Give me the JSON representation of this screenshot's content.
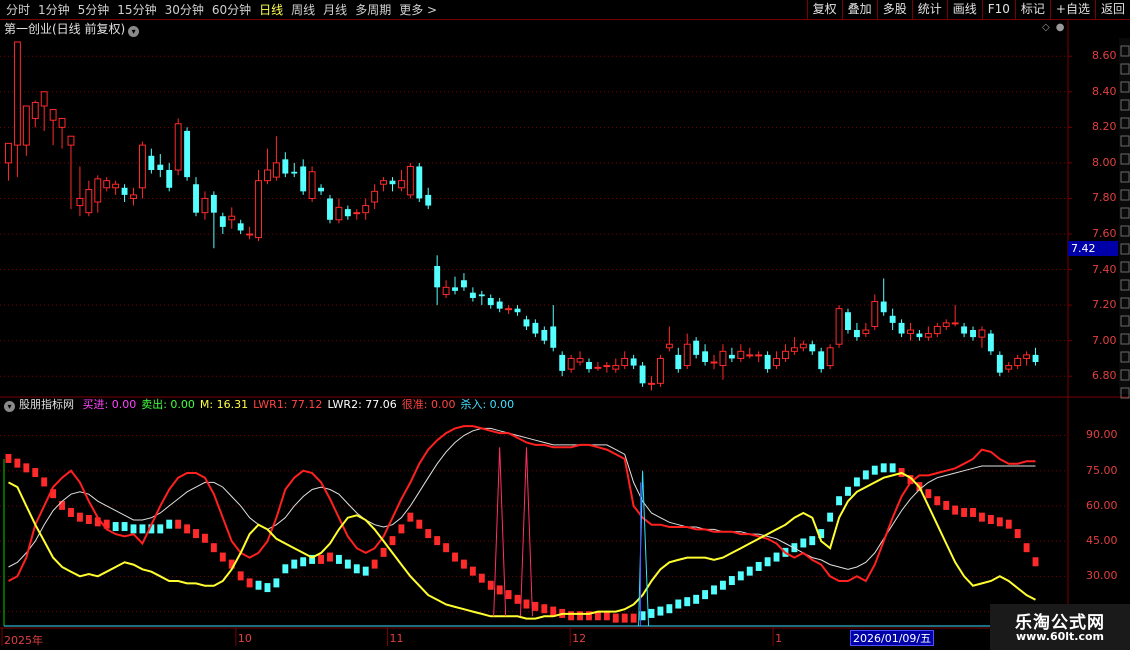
{
  "toolbar": {
    "tabs": [
      "分时",
      "1分钟",
      "5分钟",
      "15分钟",
      "30分钟",
      "60分钟",
      "日线",
      "周线",
      "月线",
      "多周期",
      "更多 >"
    ],
    "active_tab": "日线",
    "right_buttons": [
      "复权",
      "叠加",
      "多股",
      "统计",
      "画线",
      "F10",
      "标记",
      "+自选",
      "返回"
    ]
  },
  "chart_title": "第一创业(日线 前复权)",
  "indicator": {
    "name": "股朋指标网",
    "values": [
      {
        "label": "买进: 0.00",
        "color": "#ff44ff"
      },
      {
        "label": "卖出: 0.00",
        "color": "#44ff44"
      },
      {
        "label": "M: 16.31",
        "color": "#ffff44"
      },
      {
        "label": "LWR1: 77.12",
        "color": "#ff4444"
      },
      {
        "label": "LWR2: 77.06",
        "color": "#ffffff"
      },
      {
        "label": "很准: 0.00",
        "color": "#ff4444"
      },
      {
        "label": "杀入: 0.00",
        "color": "#44e0ff"
      }
    ]
  },
  "price_axis": [
    "8.60",
    "8.40",
    "8.20",
    "8.00",
    "7.80",
    "7.60",
    "7.40",
    "7.20",
    "7.00",
    "6.80"
  ],
  "current_price": "7.42",
  "indicator_axis": [
    "90.00",
    "75.00",
    "60.00",
    "45.00",
    "30.00",
    "15.00"
  ],
  "date_axis": [
    {
      "label": "2025年",
      "pos": 0.0
    },
    {
      "label": "10",
      "pos": 0.219
    },
    {
      "label": "11",
      "pos": 0.361
    },
    {
      "label": "12",
      "pos": 0.532
    },
    {
      "label": "1",
      "pos": 0.722
    }
  ],
  "cursor_date": "2026/01/09/五",
  "watermark": {
    "brand": "乐淘公式网",
    "url": "www.60lt.com"
  },
  "colors": {
    "up": "#ff2a2a",
    "down": "#54ffff",
    "grid": "#7a0000",
    "lwr1": "#ff2020",
    "lwr2": "#e0e0e0",
    "m": "#ffff30"
  },
  "chart_data": {
    "type": "candlestick",
    "ylim": [
      6.7,
      8.68
    ],
    "candles": [
      [
        8.0,
        8.11,
        8.02,
        7.9
      ],
      [
        8.1,
        8.68,
        8.12,
        7.92
      ],
      [
        8.1,
        8.32,
        8.2,
        8.04
      ],
      [
        8.25,
        8.34,
        8.35,
        8.2
      ],
      [
        8.32,
        8.4,
        8.38,
        8.18
      ],
      [
        8.24,
        8.3,
        8.28,
        8.1
      ],
      [
        8.2,
        8.25,
        8.24,
        8.08
      ],
      [
        8.1,
        8.15,
        8.14,
        7.74
      ],
      [
        7.76,
        7.8,
        7.98,
        7.7
      ],
      [
        7.72,
        7.85,
        7.9,
        7.7
      ],
      [
        7.78,
        7.91,
        7.93,
        7.72
      ],
      [
        7.86,
        7.9,
        7.92,
        7.84
      ],
      [
        7.86,
        7.88,
        7.9,
        7.82
      ],
      [
        7.86,
        7.82,
        7.88,
        7.78
      ],
      [
        7.8,
        7.82,
        7.86,
        7.76
      ],
      [
        7.86,
        8.1,
        8.12,
        7.8
      ],
      [
        8.04,
        7.96,
        8.08,
        7.94
      ],
      [
        7.99,
        7.96,
        8.05,
        7.92
      ],
      [
        7.96,
        7.86,
        8.0,
        7.84
      ],
      [
        7.96,
        8.22,
        8.25,
        7.93
      ],
      [
        8.18,
        7.92,
        8.2,
        7.9
      ],
      [
        7.88,
        7.72,
        7.92,
        7.7
      ],
      [
        7.72,
        7.8,
        7.84,
        7.68
      ],
      [
        7.82,
        7.72,
        7.84,
        7.52
      ],
      [
        7.7,
        7.64,
        7.72,
        7.6
      ],
      [
        7.68,
        7.7,
        7.75,
        7.63
      ],
      [
        7.66,
        7.62,
        7.68,
        7.6
      ],
      [
        7.6,
        7.6,
        7.64,
        7.57
      ],
      [
        7.58,
        7.9,
        7.96,
        7.56
      ],
      [
        7.9,
        7.96,
        8.08,
        7.88
      ],
      [
        7.92,
        8.0,
        8.15,
        7.9
      ],
      [
        8.02,
        7.94,
        8.06,
        7.92
      ],
      [
        7.95,
        7.94,
        8.0,
        7.92
      ],
      [
        7.98,
        7.84,
        8.02,
        7.82
      ],
      [
        7.8,
        7.95,
        7.98,
        7.78
      ],
      [
        7.86,
        7.84,
        7.88,
        7.82
      ],
      [
        7.8,
        7.68,
        7.82,
        7.66
      ],
      [
        7.68,
        7.75,
        7.8,
        7.66
      ],
      [
        7.74,
        7.7,
        7.76,
        7.68
      ],
      [
        7.72,
        7.72,
        7.74,
        7.68
      ],
      [
        7.72,
        7.76,
        7.8,
        7.68
      ],
      [
        7.78,
        7.84,
        7.88,
        7.74
      ],
      [
        7.88,
        7.9,
        7.92,
        7.84
      ],
      [
        7.9,
        7.88,
        7.92,
        7.84
      ],
      [
        7.86,
        7.9,
        7.96,
        7.84
      ],
      [
        7.82,
        7.98,
        8.0,
        7.8
      ],
      [
        7.98,
        7.8,
        8.0,
        7.78
      ],
      [
        7.82,
        7.76,
        7.86,
        7.74
      ],
      [
        7.42,
        7.3,
        7.48,
        7.2
      ],
      [
        7.26,
        7.3,
        7.34,
        7.24
      ],
      [
        7.3,
        7.28,
        7.36,
        7.26
      ],
      [
        7.34,
        7.3,
        7.38,
        7.28
      ],
      [
        7.27,
        7.24,
        7.3,
        7.22
      ],
      [
        7.26,
        7.25,
        7.28,
        7.2
      ],
      [
        7.24,
        7.2,
        7.26,
        7.18
      ],
      [
        7.22,
        7.18,
        7.24,
        7.16
      ],
      [
        7.18,
        7.18,
        7.2,
        7.15
      ],
      [
        7.18,
        7.16,
        7.2,
        7.14
      ],
      [
        7.12,
        7.08,
        7.14,
        7.06
      ],
      [
        7.1,
        7.04,
        7.12,
        7.02
      ],
      [
        7.06,
        7.0,
        7.08,
        6.98
      ],
      [
        7.08,
        6.96,
        7.2,
        6.94
      ],
      [
        6.92,
        6.83,
        6.94,
        6.8
      ],
      [
        6.84,
        6.9,
        6.92,
        6.82
      ],
      [
        6.88,
        6.9,
        6.94,
        6.86
      ],
      [
        6.88,
        6.84,
        6.9,
        6.82
      ],
      [
        6.85,
        6.85,
        6.88,
        6.83
      ],
      [
        6.86,
        6.86,
        6.88,
        6.82
      ],
      [
        6.84,
        6.86,
        6.9,
        6.82
      ],
      [
        6.86,
        6.9,
        6.94,
        6.84
      ],
      [
        6.9,
        6.86,
        6.92,
        6.84
      ],
      [
        6.86,
        6.76,
        6.88,
        6.74
      ],
      [
        6.76,
        6.76,
        6.8,
        6.72
      ],
      [
        6.76,
        6.9,
        6.92,
        6.74
      ],
      [
        6.96,
        6.98,
        7.08,
        6.94
      ],
      [
        6.92,
        6.84,
        6.96,
        6.82
      ],
      [
        6.86,
        6.98,
        7.04,
        6.84
      ],
      [
        7.0,
        6.92,
        7.02,
        6.9
      ],
      [
        6.94,
        6.88,
        6.98,
        6.86
      ],
      [
        6.88,
        6.88,
        6.92,
        6.84
      ],
      [
        6.86,
        6.94,
        6.98,
        6.78
      ],
      [
        6.92,
        6.9,
        6.96,
        6.88
      ],
      [
        6.9,
        6.94,
        6.98,
        6.88
      ],
      [
        6.92,
        6.92,
        6.96,
        6.9
      ],
      [
        6.92,
        6.92,
        6.94,
        6.88
      ],
      [
        6.92,
        6.84,
        6.94,
        6.82
      ],
      [
        6.86,
        6.9,
        6.94,
        6.84
      ],
      [
        6.9,
        6.94,
        6.98,
        6.88
      ],
      [
        6.94,
        6.96,
        7.02,
        6.92
      ],
      [
        6.96,
        6.98,
        7.0,
        6.94
      ],
      [
        6.98,
        6.94,
        7.0,
        6.92
      ],
      [
        6.94,
        6.84,
        6.96,
        6.82
      ],
      [
        6.86,
        6.96,
        6.98,
        6.84
      ],
      [
        6.98,
        7.18,
        7.2,
        6.96
      ],
      [
        7.16,
        7.06,
        7.18,
        7.04
      ],
      [
        7.06,
        7.02,
        7.1,
        7.0
      ],
      [
        7.04,
        7.06,
        7.1,
        7.02
      ],
      [
        7.08,
        7.22,
        7.26,
        7.06
      ],
      [
        7.22,
        7.16,
        7.35,
        7.14
      ],
      [
        7.14,
        7.1,
        7.18,
        7.06
      ],
      [
        7.1,
        7.04,
        7.12,
        7.02
      ],
      [
        7.04,
        7.06,
        7.1,
        7.0
      ],
      [
        7.04,
        7.02,
        7.06,
        7.0
      ],
      [
        7.02,
        7.04,
        7.08,
        7.0
      ],
      [
        7.04,
        7.08,
        7.1,
        7.02
      ],
      [
        7.08,
        7.1,
        7.12,
        7.06
      ],
      [
        7.1,
        7.1,
        7.2,
        7.08
      ],
      [
        7.08,
        7.04,
        7.1,
        7.02
      ],
      [
        7.06,
        7.02,
        7.08,
        7.0
      ],
      [
        7.02,
        7.06,
        7.08,
        6.96
      ],
      [
        7.04,
        6.94,
        7.06,
        6.92
      ],
      [
        6.92,
        6.82,
        6.94,
        6.8
      ],
      [
        6.84,
        6.86,
        6.88,
        6.82
      ],
      [
        6.86,
        6.9,
        6.92,
        6.84
      ],
      [
        6.9,
        6.92,
        6.94,
        6.86
      ],
      [
        6.92,
        6.88,
        6.96,
        6.86
      ]
    ]
  }
}
